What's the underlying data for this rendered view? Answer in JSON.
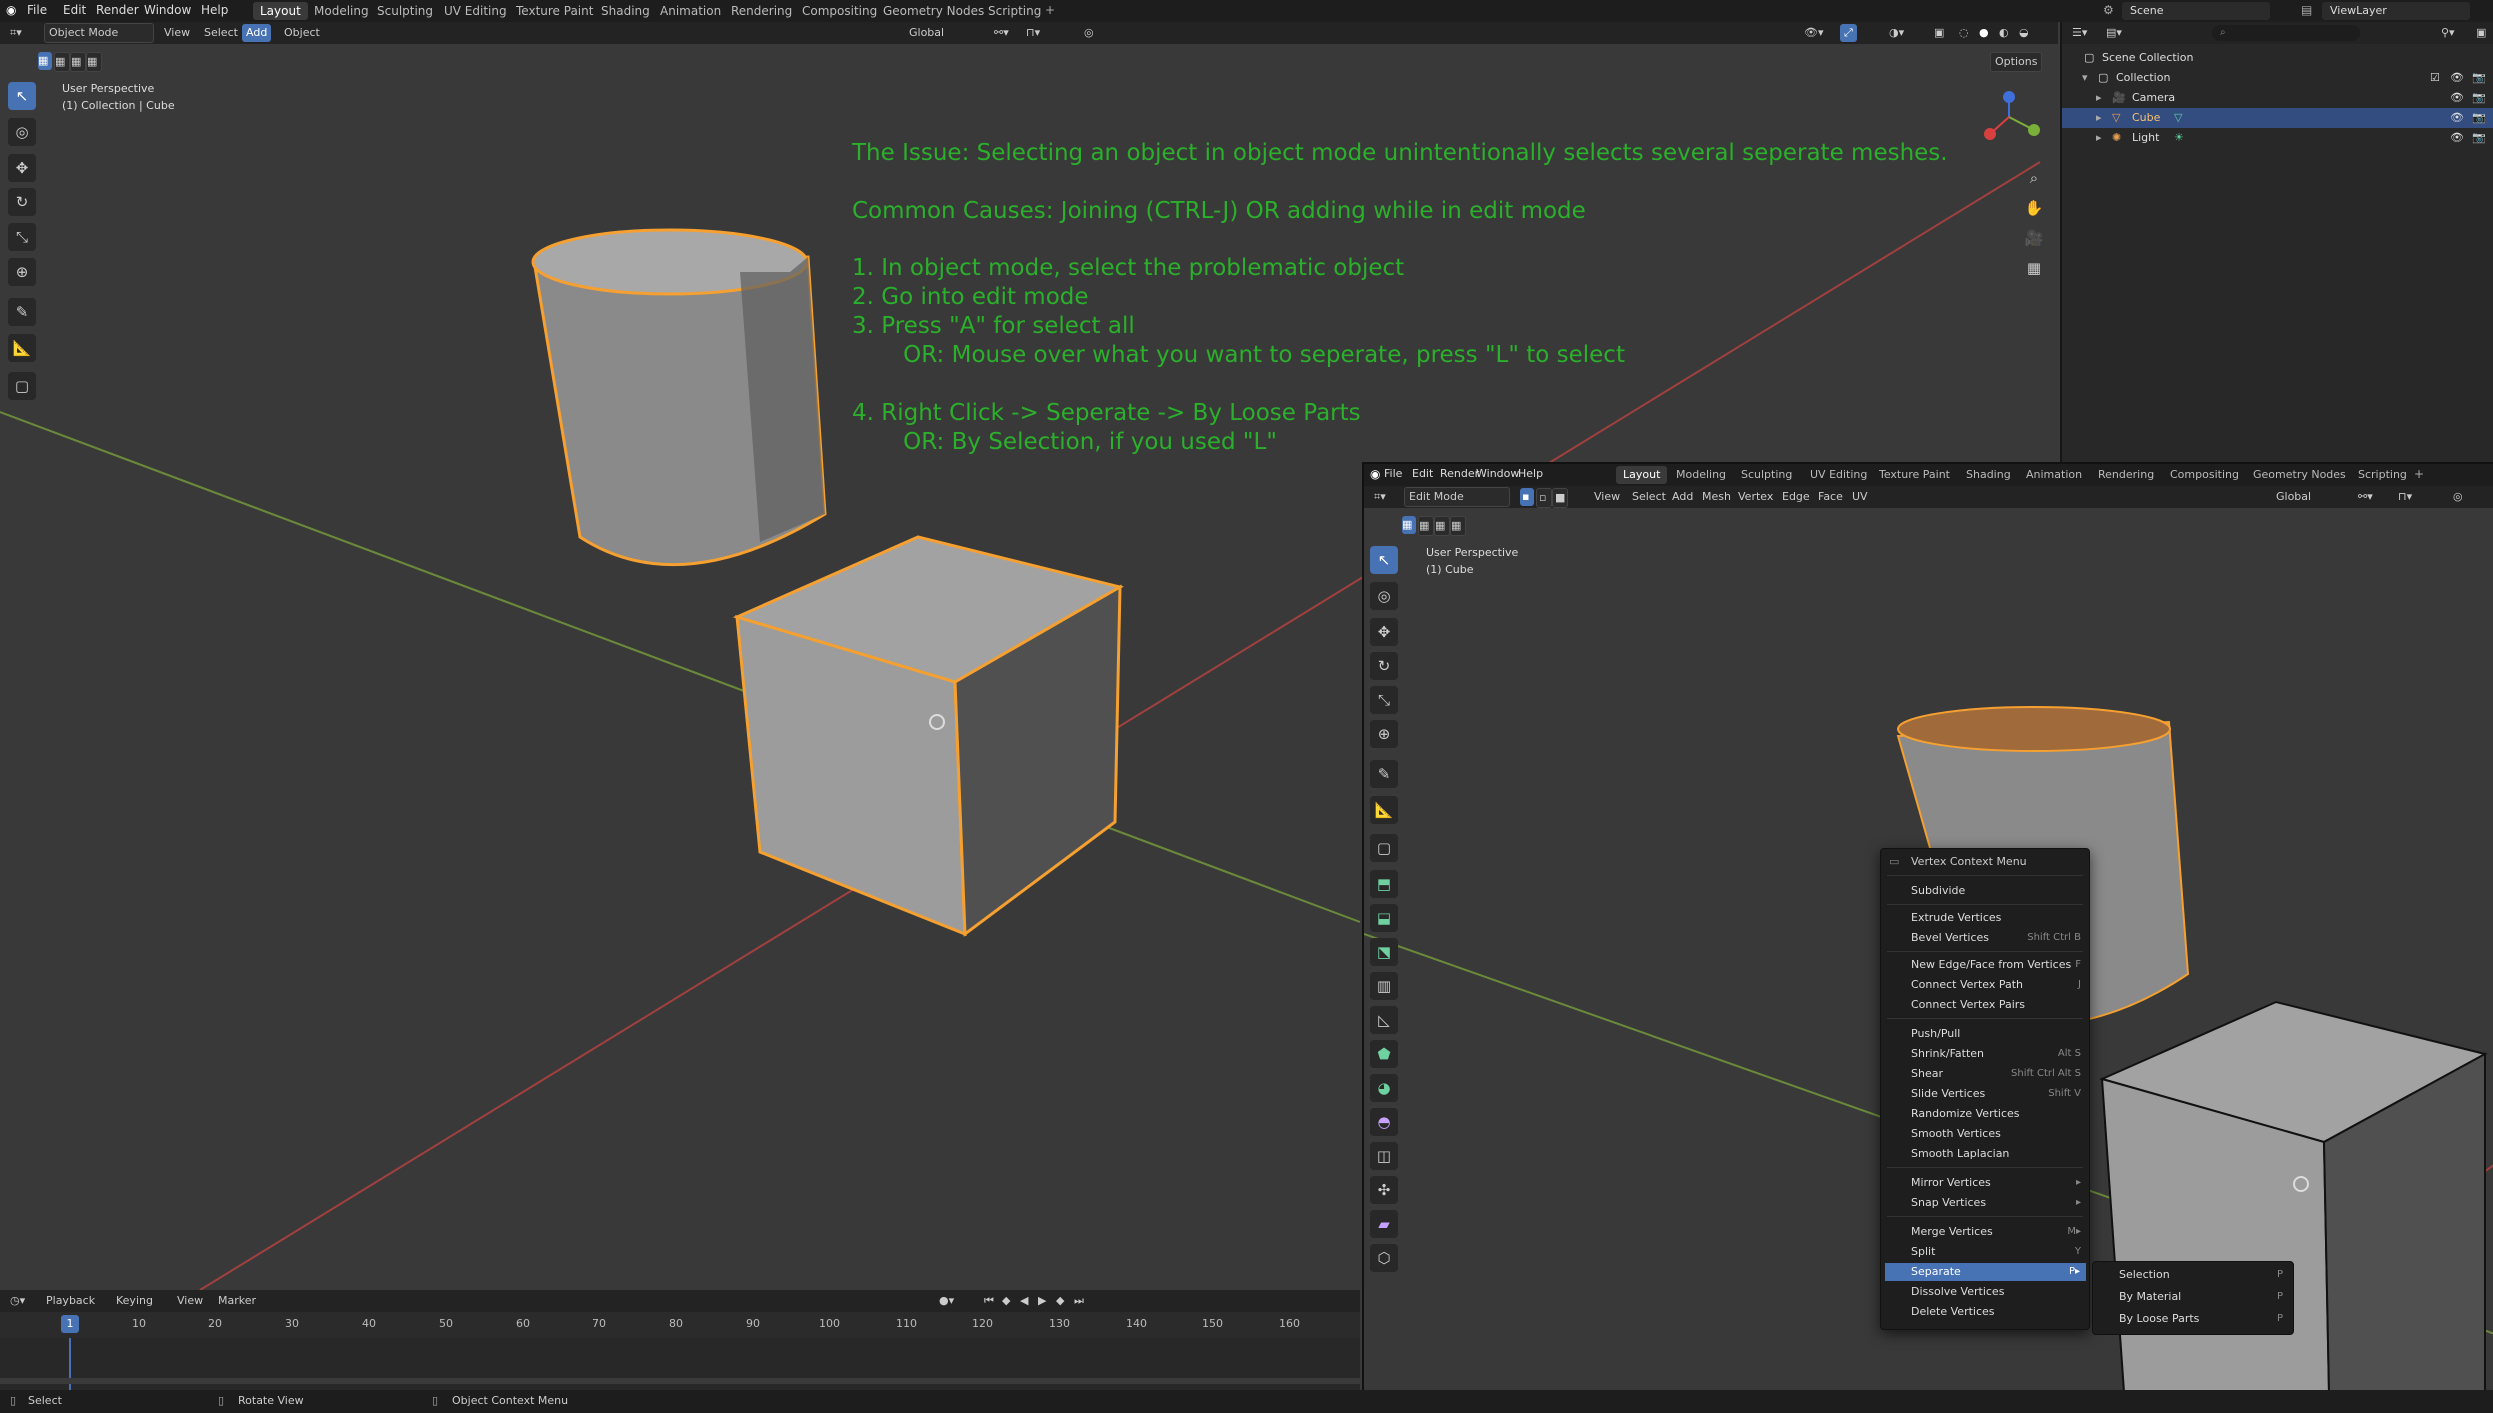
{
  "top_menu": [
    "File",
    "Edit",
    "Render",
    "Window",
    "Help"
  ],
  "workspace_tabs": [
    "Layout",
    "Modeling",
    "Sculpting",
    "UV Editing",
    "Texture Paint",
    "Shading",
    "Animation",
    "Rendering",
    "Compositing",
    "Geometry Nodes",
    "Scripting"
  ],
  "active_tab": "Layout",
  "scene_field": "Scene",
  "viewlayer_field": "ViewLayer",
  "left_view": {
    "mode": "Object Mode",
    "menus": [
      "View",
      "Select",
      "Add",
      "Object"
    ],
    "active_menu": "Add",
    "transform": "Global",
    "options": "Options",
    "perspective": "User Perspective",
    "collection_info": "(1) Collection | Cube"
  },
  "instructions": [
    "The Issue: Selecting an object in object mode unintentionally selects several seperate meshes.",
    "Common Causes: Joining (CTRL-J) OR adding while in edit mode",
    "1. In object mode, select the problematic object",
    "2. Go into edit mode",
    "3. Press \"A\" for select all",
    "       OR: Mouse over what you want to seperate, press \"L\" to select",
    "4. Right Click -> Seperate -> By Loose Parts",
    "       OR: By Selection, if you used \"L\""
  ],
  "outliner": {
    "rows": [
      "Scene Collection",
      "Collection",
      "Camera",
      "Cube",
      "Light"
    ],
    "selected": "Cube"
  },
  "right_window": {
    "menu": [
      "File",
      "Edit",
      "Render",
      "Window",
      "Help"
    ],
    "tabs": [
      "Layout",
      "Modeling",
      "Sculpting",
      "UV Editing",
      "Texture Paint",
      "Shading",
      "Animation",
      "Rendering",
      "Compositing",
      "Geometry Nodes",
      "Scripting"
    ],
    "mode": "Edit Mode",
    "menus": [
      "View",
      "Select",
      "Add",
      "Mesh",
      "Vertex",
      "Edge",
      "Face",
      "UV"
    ],
    "transform": "Global",
    "perspective": "User Perspective",
    "object_info": "(1) Cube"
  },
  "context_menu": {
    "title": "Vertex Context Menu",
    "items": [
      {
        "label": "Subdivide",
        "shortcut": ""
      },
      {
        "label": "Extrude Vertices",
        "shortcut": ""
      },
      {
        "label": "Bevel Vertices",
        "shortcut": "Shift Ctrl B"
      },
      {
        "label": "New Edge/Face from Vertices",
        "shortcut": "F"
      },
      {
        "label": "Connect Vertex Path",
        "shortcut": "J"
      },
      {
        "label": "Connect Vertex Pairs",
        "shortcut": ""
      },
      {
        "label": "Push/Pull",
        "shortcut": ""
      },
      {
        "label": "Shrink/Fatten",
        "shortcut": "Alt S"
      },
      {
        "label": "Shear",
        "shortcut": "Shift Ctrl Alt S"
      },
      {
        "label": "Slide Vertices",
        "shortcut": "Shift V"
      },
      {
        "label": "Randomize Vertices",
        "shortcut": ""
      },
      {
        "label": "Smooth Vertices",
        "shortcut": ""
      },
      {
        "label": "Smooth Laplacian",
        "shortcut": ""
      },
      {
        "label": "Mirror Vertices",
        "shortcut": "▸"
      },
      {
        "label": "Snap Vertices",
        "shortcut": "▸"
      },
      {
        "label": "Merge Vertices",
        "shortcut": "M▸"
      },
      {
        "label": "Split",
        "shortcut": "Y"
      },
      {
        "label": "Separate",
        "shortcut": "P▸"
      },
      {
        "label": "Dissolve Vertices",
        "shortcut": ""
      },
      {
        "label": "Delete Vertices",
        "shortcut": ""
      }
    ],
    "highlighted": "Separate"
  },
  "separate_submenu": [
    {
      "label": "Selection",
      "shortcut": "P"
    },
    {
      "label": "By Material",
      "shortcut": "P"
    },
    {
      "label": "By Loose Parts",
      "shortcut": "P"
    }
  ],
  "timeline": {
    "menus": [
      "Playback",
      "Keying",
      "View",
      "Marker"
    ],
    "current_frame": "1",
    "ticks": [
      "10",
      "20",
      "30",
      "40",
      "50",
      "60",
      "70",
      "80",
      "90",
      "100",
      "110",
      "120",
      "130",
      "140",
      "150",
      "160"
    ]
  },
  "status": [
    "Select",
    "Rotate View",
    "Object Context Menu"
  ],
  "colors": {
    "accent": "#4772b3",
    "selection_outline": "#f5a030",
    "instruction_text": "#2bb02b"
  }
}
